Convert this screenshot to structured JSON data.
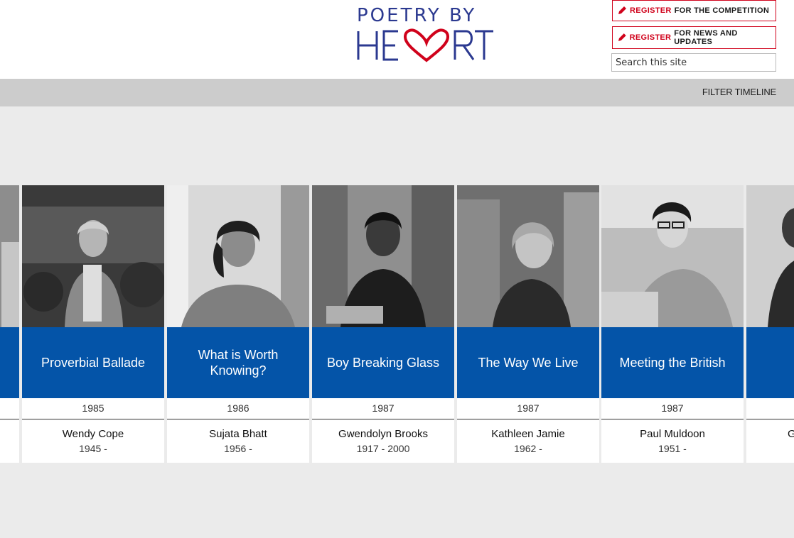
{
  "header": {
    "logo_top": "POETRY BY",
    "logo_bottom": "HEART",
    "register_competition": {
      "highlight": "REGISTER",
      "rest": "FOR THE COMPETITION"
    },
    "register_news": {
      "highlight": "REGISTER",
      "rest": "FOR NEWS AND UPDATES"
    },
    "search_placeholder": "Search this site",
    "brand_red": "#d0021b",
    "brand_blue": "#2b3990"
  },
  "filterbar": {
    "label": "FILTER TIMELINE"
  },
  "accent": "#0454a8",
  "timeline": {
    "cards": [
      {
        "title": "",
        "year": "",
        "poet": "",
        "dates": ""
      },
      {
        "title": "Proverbial Ballade",
        "year": "1985",
        "poet": "Wendy Cope",
        "dates": "1945 -"
      },
      {
        "title": "What is Worth Knowing?",
        "year": "1986",
        "poet": "Sujata Bhatt",
        "dates": "1956 -"
      },
      {
        "title": "Boy Breaking Glass",
        "year": "1987",
        "poet": "Gwendolyn Brooks",
        "dates": "1917 - 2000"
      },
      {
        "title": "The Way We Live",
        "year": "1987",
        "poet": "Kathleen Jamie",
        "dates": "1962 -"
      },
      {
        "title": "Meeting the British",
        "year": "1987",
        "poet": "Paul Muldoon",
        "dates": "1951 -"
      },
      {
        "title": "",
        "year": "",
        "poet": "G",
        "dates": ""
      }
    ]
  }
}
